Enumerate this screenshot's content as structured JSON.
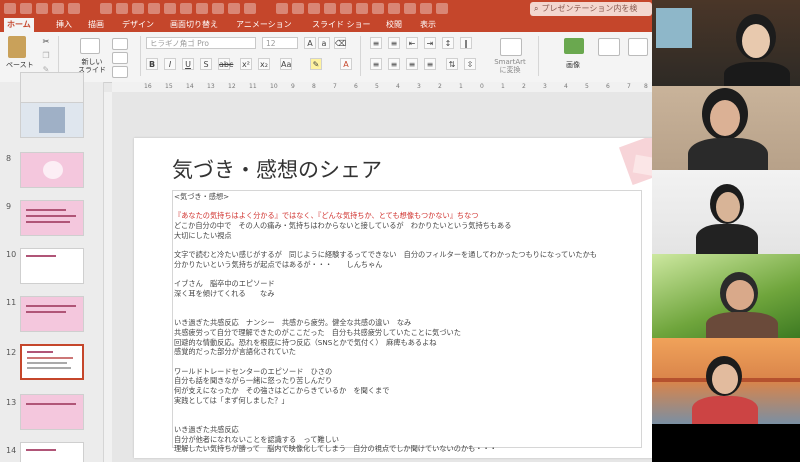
{
  "ribbon": {
    "tabs": [
      "ホーム",
      "挿入",
      "描画",
      "デザイン",
      "画面切り替え",
      "アニメーション",
      "スライド ショー",
      "校閲",
      "表示"
    ],
    "search_placeholder": "プレゼンテーション内を検",
    "font_name": "ヒラギノ角ゴ Pro",
    "font_size": "12",
    "paste_label": "ペースト",
    "new_slide_label": "新しい\nスライド",
    "smartart_label": "SmartArt\nに変換",
    "picture_label": "画像",
    "accent_color": "#c5462b"
  },
  "ruler": {
    "ticks": [
      "16",
      "15",
      "14",
      "13",
      "12",
      "11",
      "10",
      "9",
      "8",
      "7",
      "6",
      "5",
      "4",
      "3",
      "2",
      "1",
      "0",
      "1",
      "2",
      "3",
      "4",
      "5",
      "6",
      "7",
      "8"
    ]
  },
  "thumbnails": {
    "numbers": [
      "8",
      "9",
      "10",
      "11",
      "12",
      "13",
      "14"
    ],
    "selected": "12"
  },
  "slide": {
    "title": "気づき・感想のシェア",
    "lines": [
      {
        "text": "<気づき・感想>",
        "style": "normal"
      },
      {
        "text": "",
        "style": "normal"
      },
      {
        "text": "『あなたの気持ちはよく分かる』ではなく、『どんな気持ちか、とても想像もつかない』ちなつ",
        "style": "red"
      },
      {
        "text": "どこか自分の中で　その人の痛み・気持ちはわからないと接しているが　わかりたいという気持ちもある",
        "style": "normal"
      },
      {
        "text": "大切にしたい視点",
        "style": "normal"
      },
      {
        "text": "",
        "style": "normal"
      },
      {
        "text": "文字で読むと冷たい感じがするが　同じように経験するってできない　自分のフィルターを通してわかったつもりになっていたかも",
        "style": "normal"
      },
      {
        "text": "分かりたいという気持ちが起点ではあるが・・・　　しんちゃん",
        "style": "normal"
      },
      {
        "text": "",
        "style": "normal"
      },
      {
        "text": "イブさん　脳卒中のエピソード",
        "style": "normal"
      },
      {
        "text": "深く耳を傾けてくれる　　なみ",
        "style": "normal"
      },
      {
        "text": "",
        "style": "normal"
      },
      {
        "text": "",
        "style": "normal"
      },
      {
        "text": "いき過ぎた共感反応　ナンシー　共感から疲労。健全な共感の違い　なみ",
        "style": "normal"
      },
      {
        "text": "共感疲労って自分で理解できたのがここだった　自分も共感疲労していたことに気づいた",
        "style": "normal"
      },
      {
        "text": "回避的な情動反応。恐れを根底に持つ反応（SNSとかで気付く）　麻痺もあるよね",
        "style": "normal"
      },
      {
        "text": "感覚的だった部分が言語化されていた",
        "style": "normal"
      },
      {
        "text": "",
        "style": "normal"
      },
      {
        "text": "ワールドトレードセンターのエピソード　ひさの",
        "style": "normal"
      },
      {
        "text": "自分も話を聞きながら一緒に怒ったり苦しんだり",
        "style": "normal"
      },
      {
        "text": "何が支えになったか　その強さはどこからきているか　を聞くまで",
        "style": "normal"
      },
      {
        "text": "実践としては「まず何しました？」",
        "style": "normal"
      },
      {
        "text": "",
        "style": "normal"
      },
      {
        "text": "",
        "style": "normal"
      },
      {
        "text": "いき過ぎた共感反応",
        "style": "normal"
      },
      {
        "text": "自分が他者になれないことを認識する　って難しい",
        "style": "normal"
      },
      {
        "text": "理解したい気持ちが勝って　脳内で映像化してしまう　自分の視点でしか聞けていないのかも・・・",
        "style": "normal"
      }
    ]
  },
  "video_tiles": [
    "participant-1",
    "participant-2",
    "participant-3",
    "participant-4",
    "participant-5"
  ]
}
